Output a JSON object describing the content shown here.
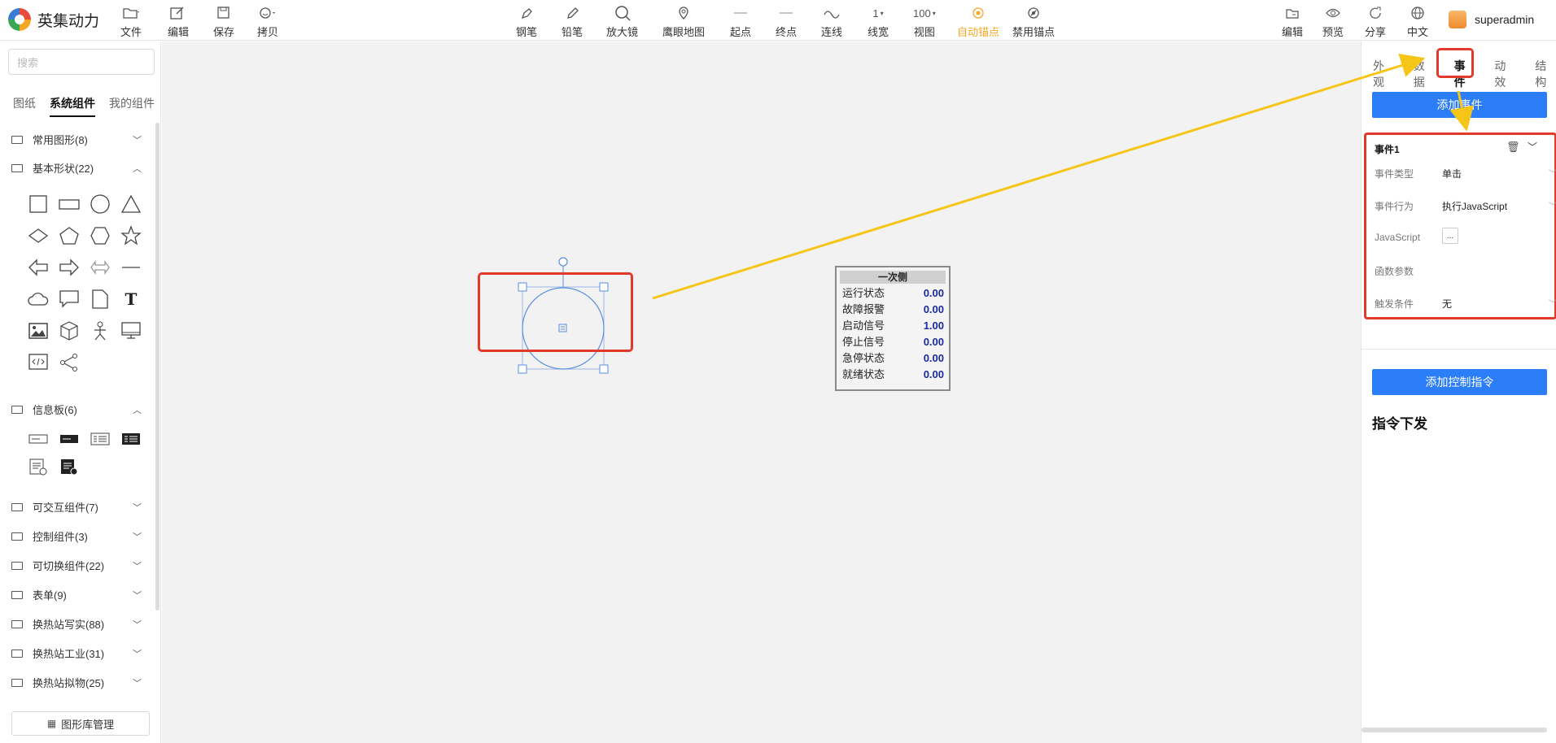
{
  "app": {
    "name": "英集动力"
  },
  "toolbar_left": [
    {
      "label": "文件",
      "icon": "folder-icon"
    },
    {
      "label": "编辑",
      "icon": "edit-icon"
    },
    {
      "label": "保存",
      "icon": "save-icon"
    },
    {
      "label": "拷贝",
      "icon": "smile-icon"
    }
  ],
  "toolbar_center": [
    {
      "label": "钢笔",
      "icon": "pen-icon"
    },
    {
      "label": "铅笔",
      "icon": "pencil-icon"
    },
    {
      "label": "放大镜",
      "icon": "magnifier-icon"
    },
    {
      "label": "鹰眼地图",
      "icon": "location-pin-icon"
    },
    {
      "label": "起点",
      "icon": "line-start-icon"
    },
    {
      "label": "终点",
      "icon": "line-end-icon"
    },
    {
      "label": "连线",
      "icon": "curve-icon"
    },
    {
      "label": "线宽",
      "value": "1"
    },
    {
      "label": "视图",
      "value": "100"
    },
    {
      "label": "自动锚点",
      "icon": "target-icon"
    },
    {
      "label": "禁用锚点",
      "icon": "no-anchor-icon"
    }
  ],
  "toolbar_right": [
    {
      "label": "编辑",
      "icon": "folder-edit-icon"
    },
    {
      "label": "预览",
      "icon": "eye-icon"
    },
    {
      "label": "分享",
      "icon": "share-icon"
    },
    {
      "label": "中文",
      "icon": "globe-icon"
    }
  ],
  "user": {
    "name": "superadmin"
  },
  "sidebar": {
    "search_placeholder": "搜索",
    "tabs": [
      "图纸",
      "系统组件",
      "我的组件"
    ],
    "active_tab": "系统组件",
    "groups": [
      {
        "label": "常用图形(8)",
        "expanded": false
      },
      {
        "label": "基本形状(22)",
        "expanded": true
      },
      {
        "label": "信息板(6)",
        "expanded": true
      },
      {
        "label": "可交互组件(7)",
        "expanded": false
      },
      {
        "label": "控制组件(3)",
        "expanded": false
      },
      {
        "label": "可切换组件(22)",
        "expanded": false
      },
      {
        "label": "表单(9)",
        "expanded": false
      },
      {
        "label": "换热站写实(88)",
        "expanded": false
      },
      {
        "label": "换热站工业(31)",
        "expanded": false
      },
      {
        "label": "换热站拟物(25)",
        "expanded": false
      }
    ],
    "library_button": "图形库管理"
  },
  "infoboard": {
    "title": "一次侧",
    "rows": [
      {
        "label": "运行状态",
        "value": "0.00"
      },
      {
        "label": "故障报警",
        "value": "0.00"
      },
      {
        "label": "启动信号",
        "value": "1.00"
      },
      {
        "label": "停止信号",
        "value": "0.00"
      },
      {
        "label": "急停状态",
        "value": "0.00"
      },
      {
        "label": "就绪状态",
        "value": "0.00"
      }
    ]
  },
  "panel": {
    "tabs": [
      "外观",
      "数据",
      "事件",
      "动效",
      "结构"
    ],
    "active_tab": "事件",
    "add_event": "添加事件",
    "event": {
      "title": "事件1",
      "type_label": "事件类型",
      "type_value": "单击",
      "action_label": "事件行为",
      "action_value": "执行JavaScript",
      "js_label": "JavaScript",
      "js_button": "...",
      "params_label": "函数参数",
      "trigger_label": "触发条件",
      "trigger_value": "无"
    },
    "add_command": "添加控制指令",
    "command_title": "指令下发"
  },
  "colors": {
    "accent": "#2c7ef8",
    "highlight": "#e23a2a",
    "arrow": "#f5c518",
    "active_tool": "#f5a623"
  }
}
